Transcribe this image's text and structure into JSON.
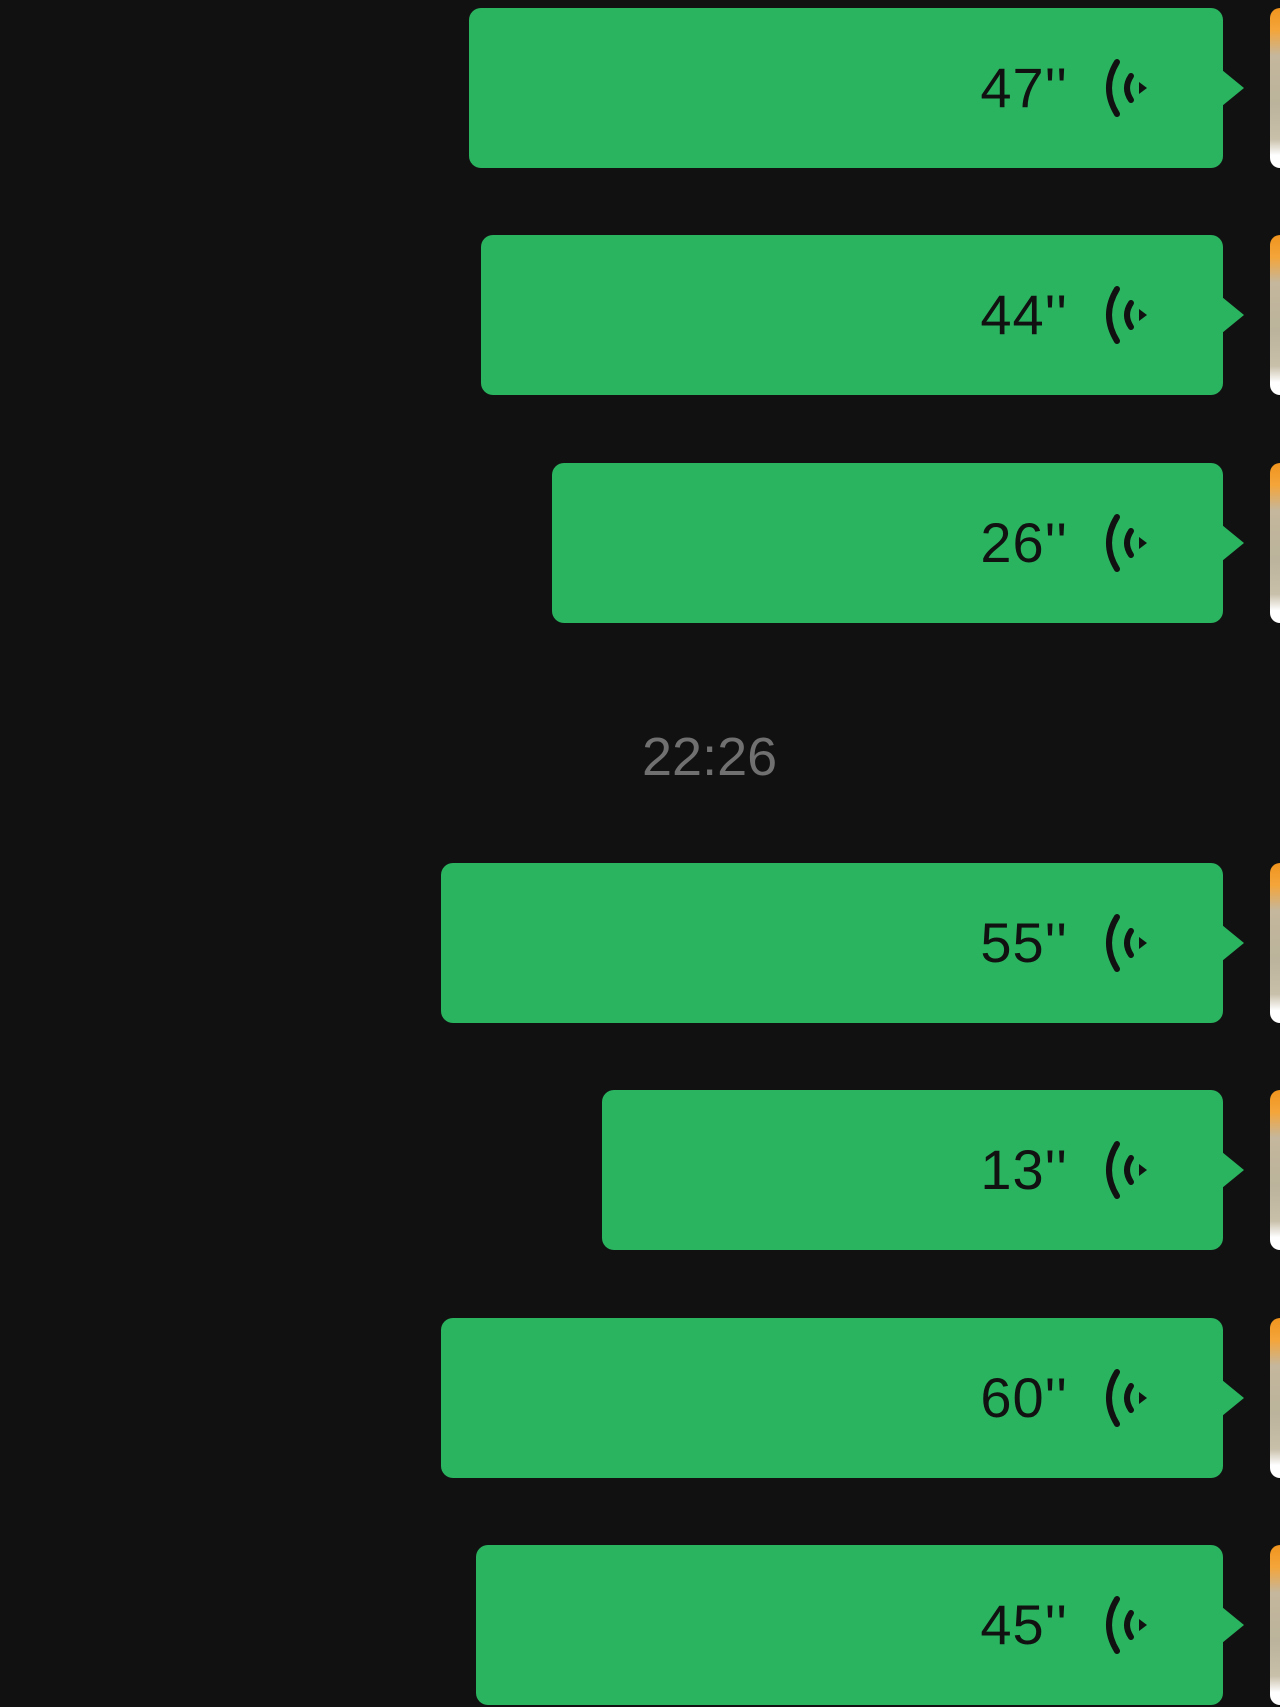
{
  "colors": {
    "background": "#111111",
    "bubble": "#2ab45f",
    "text": "#111111",
    "timestamp": "#707070"
  },
  "messages_before": [
    {
      "duration": "47''",
      "icon": "voice-playback-icon"
    },
    {
      "duration": "44''",
      "icon": "voice-playback-icon"
    },
    {
      "duration": "26''",
      "icon": "voice-playback-icon"
    }
  ],
  "timestamp": "22:26",
  "messages_after": [
    {
      "duration": "55''",
      "icon": "voice-playback-icon"
    },
    {
      "duration": "13''",
      "icon": "voice-playback-icon"
    },
    {
      "duration": "60''",
      "icon": "voice-playback-icon"
    },
    {
      "duration": "45''",
      "icon": "voice-playback-icon"
    }
  ]
}
